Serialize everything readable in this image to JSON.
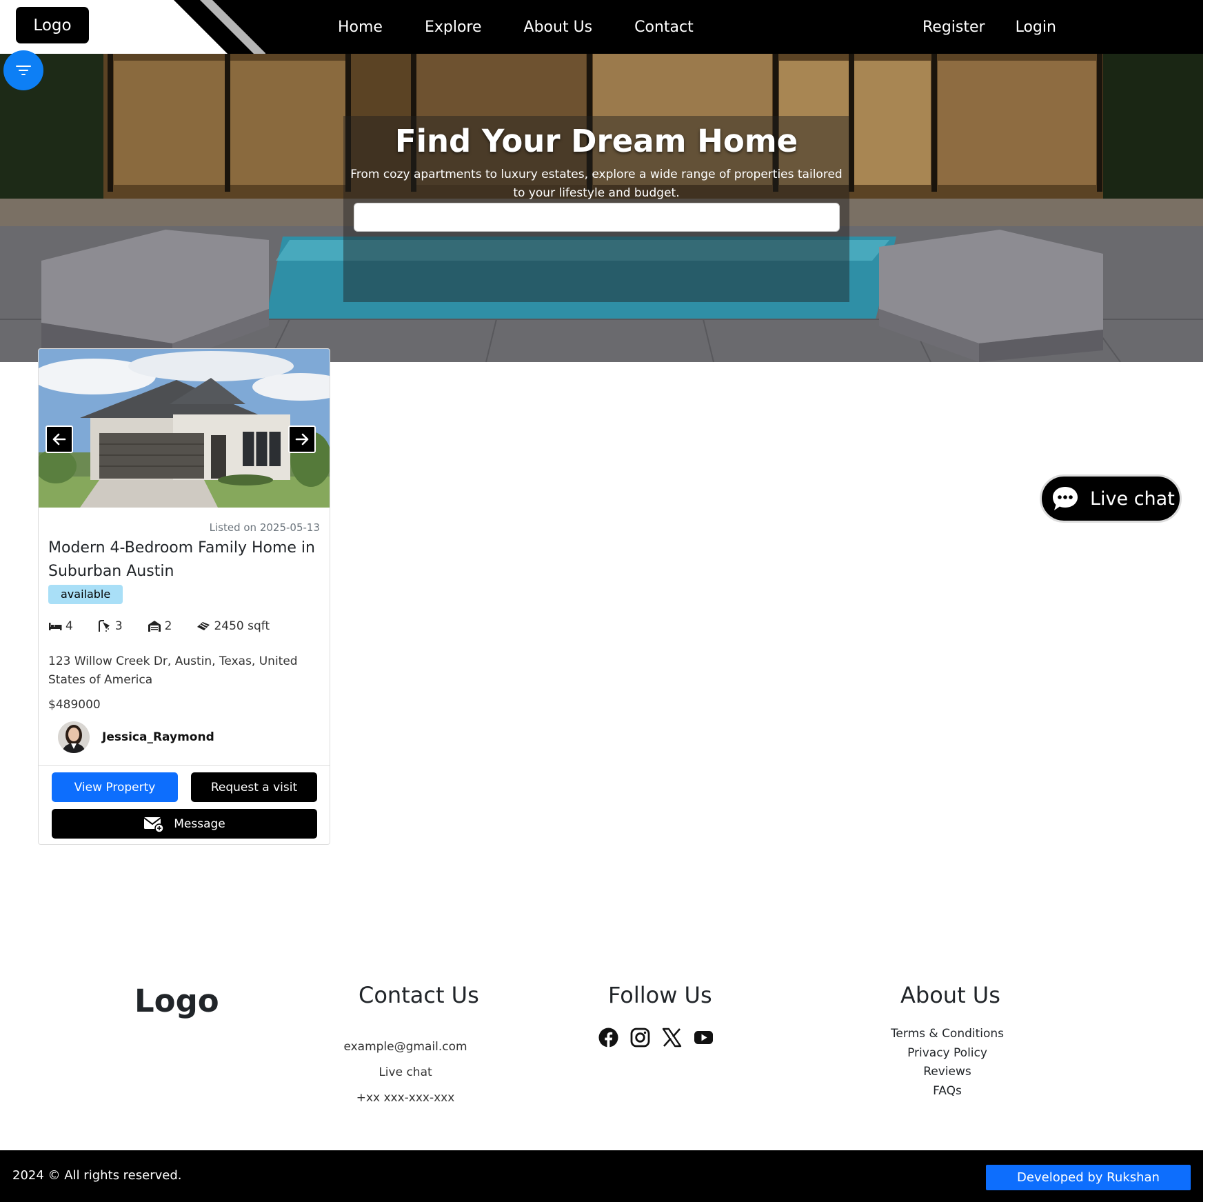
{
  "nav": {
    "logo": "Logo",
    "links": [
      "Home",
      "Explore",
      "About Us",
      "Contact"
    ],
    "register": "Register",
    "login": "Login"
  },
  "hero": {
    "title": "Find Your Dream Home",
    "subtitle": "From cozy apartments to luxury estates, explore a wide range of properties tailored to your lifestyle and budget.",
    "search_placeholder": ""
  },
  "property": {
    "listed": "Listed on 2025-05-13",
    "title": "Modern 4-Bedroom Family Home in Suburban Austin",
    "status": "available",
    "bedrooms": "4",
    "bathrooms": "3",
    "garages": "2",
    "area": "2450 sqft",
    "address": "123 Willow Creek Dr, Austin, Texas, United States of America",
    "price": "$489000",
    "agent": "Jessica_Raymond",
    "view_label": "View Property",
    "visit_label": "Request a visit",
    "message_label": "Message"
  },
  "livechat": {
    "label": "Live chat"
  },
  "footer": {
    "logo": "Logo",
    "contact_title": "Contact Us",
    "contact_email": "example@gmail.com",
    "contact_chat": "Live chat",
    "contact_phone": "+xx xxx-xxx-xxx",
    "follow_title": "Follow Us",
    "social_icons": [
      "facebook-icon",
      "instagram-icon",
      "x-icon",
      "youtube-icon"
    ],
    "about_title": "About Us",
    "about_links": [
      "Terms & Conditions",
      "Privacy Policy",
      "Reviews",
      "FAQs"
    ],
    "copyright": "2024 © All rights reserved.",
    "developer": "Developed by Rukshan"
  },
  "colors": {
    "primary": "#0d6efd",
    "filter_fab": "#0d7ff5",
    "badge": "#a9dff7",
    "nav_bg": "#000000"
  }
}
